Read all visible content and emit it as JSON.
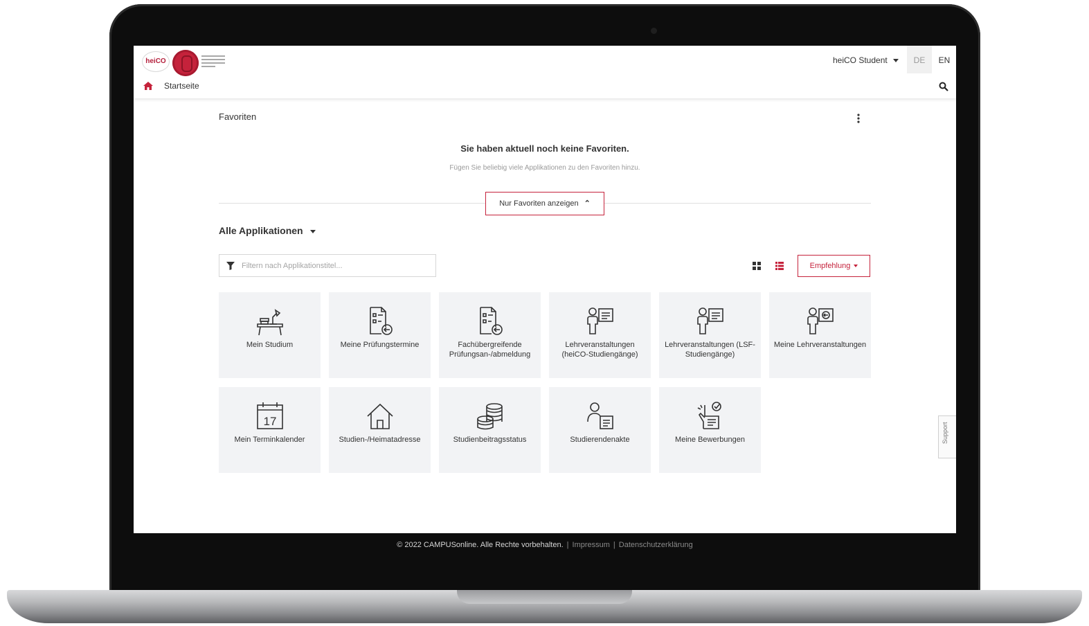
{
  "colors": {
    "accent": "#c5223b",
    "tile_bg": "#f2f3f5",
    "text": "#333333"
  },
  "header": {
    "logo_text": "heiCO",
    "user_menu": "heiCO Student",
    "lang_de": "DE",
    "lang_en": "EN",
    "breadcrumb": "Startseite"
  },
  "favorites": {
    "title": "Favoriten",
    "empty_title": "Sie haben aktuell noch keine Favoriten.",
    "empty_sub": "Fügen Sie beliebig viele Applikationen zu den Favoriten hinzu.",
    "toggle_label": "Nur Favoriten anzeigen"
  },
  "apps": {
    "title": "Alle Applikationen",
    "filter_placeholder": "Filtern nach Applikationstitel...",
    "sort_label": "Empfehlung",
    "tiles": [
      {
        "label": "Mein Studium",
        "icon": "desk-icon"
      },
      {
        "label": "Meine Prüfungstermine",
        "icon": "exam-dates-icon"
      },
      {
        "label": "Fachübergreifende Prüfungsan-/abmeldung",
        "icon": "exam-registration-icon"
      },
      {
        "label": "Lehrveranstaltungen (heiCO-Studiengänge)",
        "icon": "lecturer-board-icon"
      },
      {
        "label": "Lehrveranstaltungen (LSF-Studiengänge)",
        "icon": "lecturer-board-icon"
      },
      {
        "label": "Meine Lehrveranstaltungen",
        "icon": "my-courses-icon"
      },
      {
        "label": "Mein Terminkalender",
        "icon": "calendar-icon",
        "calendar_day": "17"
      },
      {
        "label": "Studien-/Heimatadresse",
        "icon": "house-icon"
      },
      {
        "label": "Studienbeitragsstatus",
        "icon": "coins-icon"
      },
      {
        "label": "Studierendenakte",
        "icon": "student-file-icon"
      },
      {
        "label": "Meine Bewerbungen",
        "icon": "applications-icon"
      }
    ]
  },
  "support_label": "Support",
  "footer": {
    "copyright": "© 2022 CAMPUSonline. Alle Rechte vorbehalten.",
    "separator": "|",
    "impressum": "Impressum",
    "privacy": "Datenschutzerklärung"
  }
}
